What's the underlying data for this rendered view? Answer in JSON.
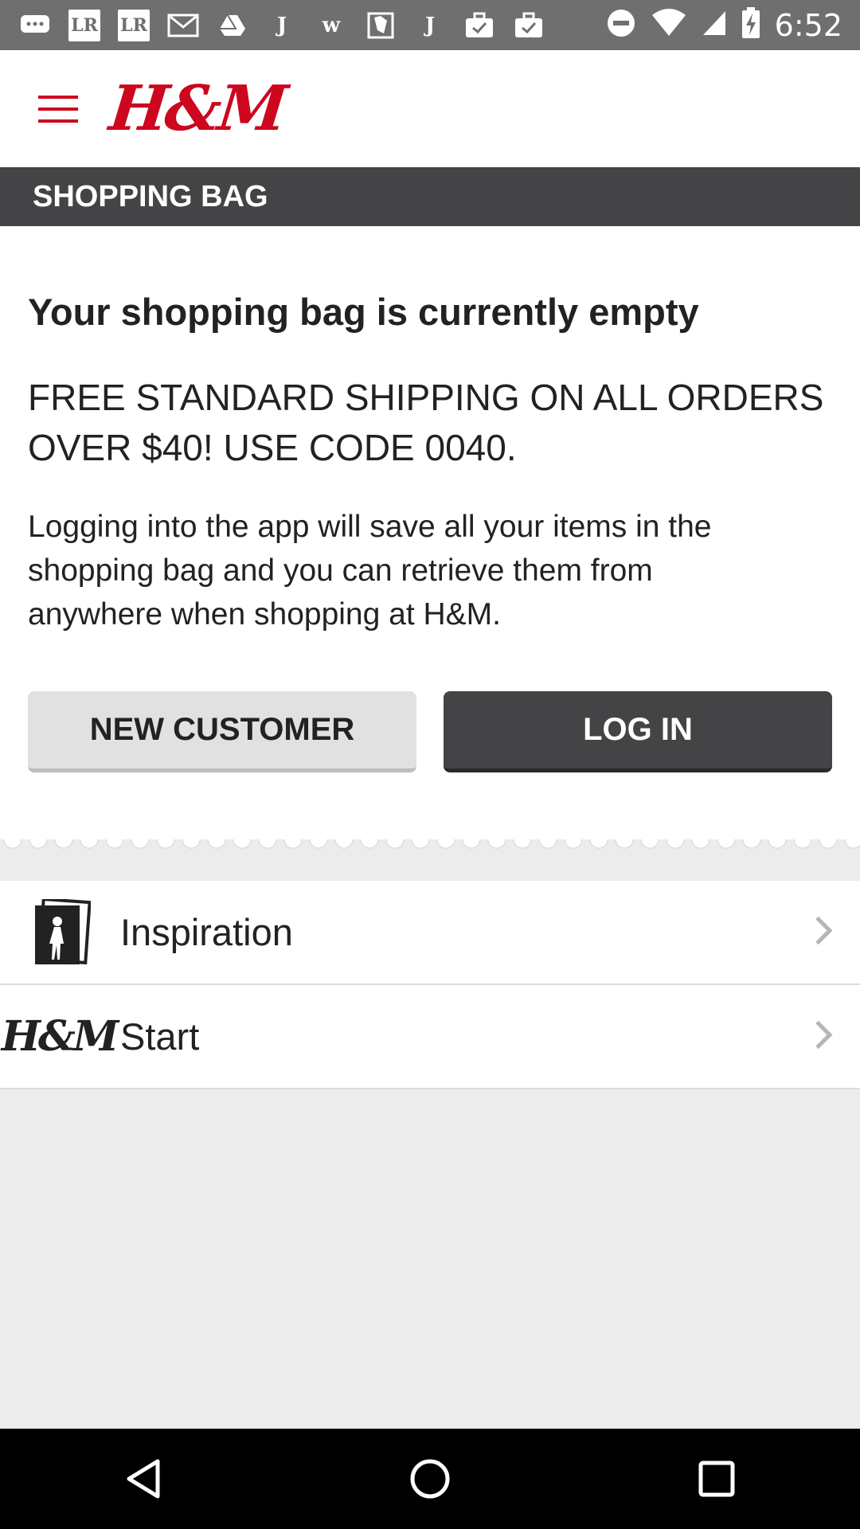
{
  "status_bar": {
    "time": "6:52",
    "notification_icons": [
      "chat-bubble-icon",
      "lr-icon",
      "lr-icon",
      "gmail-icon",
      "drive-icon",
      "j-icon",
      "w-icon",
      "map-icon",
      "j-icon",
      "briefcase-check-icon",
      "briefcase-check-icon"
    ],
    "lr_text": "LR"
  },
  "app_bar": {
    "logo": "H&M"
  },
  "section": {
    "title": "SHOPPING BAG"
  },
  "empty_state": {
    "title": "Your shopping bag is currently empty",
    "promo": "FREE STANDARD SHIPPING ON ALL ORDERS OVER $40! USE CODE 0040.",
    "info": "Logging into the app will save all your items in the shopping bag and you can retrieve them from anywhere when shopping at H&M."
  },
  "buttons": {
    "new_customer": "NEW CUSTOMER",
    "log_in": "LOG IN"
  },
  "list": {
    "items": [
      {
        "label": "Inspiration",
        "icon": "inspiration-icon"
      },
      {
        "label": "Start",
        "icon": "hm-logo-icon"
      }
    ]
  },
  "colors": {
    "brand_red": "#cc071e",
    "dark": "#444446",
    "background": "#ececec"
  }
}
